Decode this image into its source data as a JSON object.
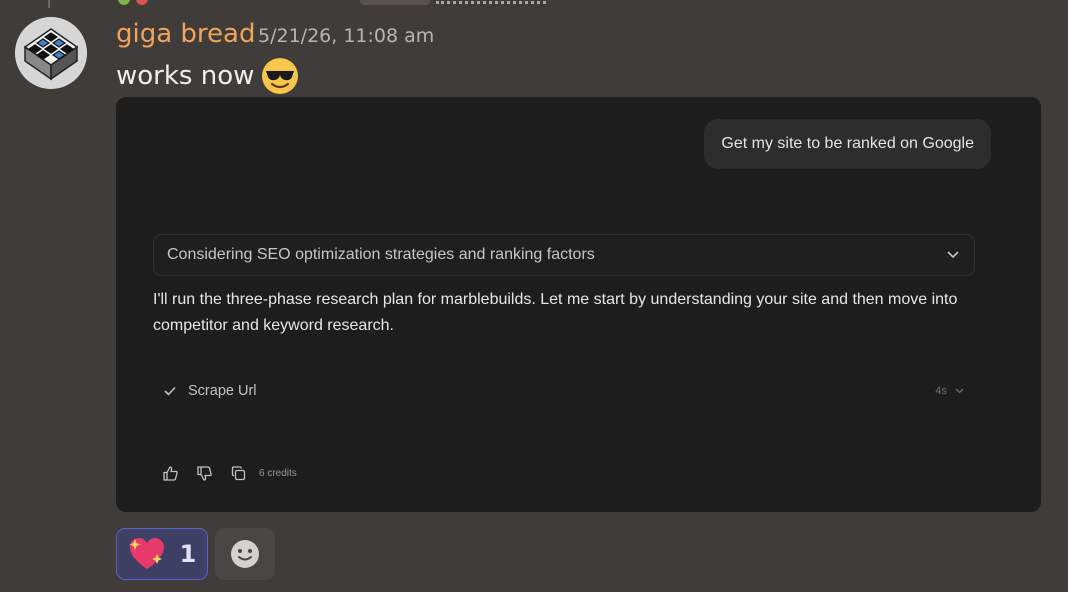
{
  "message": {
    "author": "giga bread",
    "timestamp": "5/21/26, 11:08 am",
    "text": "works now",
    "text_emoji": "smiling-face-with-sunglasses"
  },
  "embed": {
    "user_prompt": "Get my site to be ranked on Google",
    "thinking_label": "Considering SEO optimization strategies and ranking factors",
    "reply_text": "I'll run the three-phase research plan for marblebuilds. Let me start by understanding your site and then move into competitor and keyword research.",
    "tool_name": "Scrape Url",
    "tool_duration": "4s",
    "credits": "6 credits"
  },
  "reactions": [
    {
      "emoji": "sparkling-heart",
      "count": "1"
    }
  ],
  "colors": {
    "background": "#403c3a",
    "author": "#f0a35c",
    "embed_bg": "#1d1d1d",
    "reaction_bg": "#3d3f64",
    "reaction_border": "#5a62c8"
  }
}
